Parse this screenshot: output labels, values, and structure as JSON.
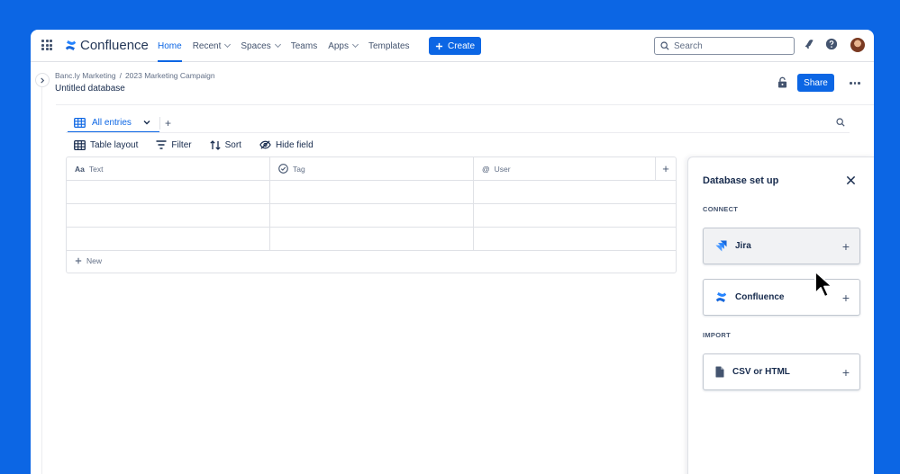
{
  "nav": {
    "product": "Confluence",
    "links": [
      {
        "label": "Home",
        "dropdown": false
      },
      {
        "label": "Recent",
        "dropdown": true
      },
      {
        "label": "Spaces",
        "dropdown": true
      },
      {
        "label": "Teams",
        "dropdown": false
      },
      {
        "label": "Apps",
        "dropdown": true
      },
      {
        "label": "Templates",
        "dropdown": false
      }
    ],
    "create_label": "Create",
    "search_placeholder": "Search",
    "icons": [
      "app-switcher-icon",
      "notifications-icon",
      "help-icon",
      "avatar"
    ]
  },
  "page": {
    "breadcrumb": [
      "Banc.ly Marketing",
      "/",
      "2023 Marketing Campaign"
    ],
    "title": "Untitled database",
    "share_label": "Share"
  },
  "database": {
    "view": {
      "label": "All entries"
    },
    "add_view": "+",
    "toolbar": {
      "layout": "Table layout",
      "filter": "Filter",
      "sort": "Sort",
      "hide": "Hide field"
    },
    "columns": [
      {
        "icon": "Aa",
        "label": "Text"
      },
      {
        "icon": "tag-icon",
        "label": "Tag"
      },
      {
        "icon": "@",
        "label": "User"
      }
    ],
    "add_column": "+",
    "new_row_label": "New"
  },
  "panel": {
    "title": "Database set up",
    "connect_label": "CONNECT",
    "import_label": "IMPORT",
    "connect_options": [
      {
        "label": "Jira",
        "icon": "jira-icon"
      },
      {
        "label": "Confluence",
        "icon": "confluence-icon"
      }
    ],
    "import_options": [
      {
        "label": "CSV or HTML",
        "icon": "file-icon"
      }
    ]
  },
  "colors": {
    "background": "#0C66E4",
    "accent": "#0C66E4",
    "text": "#172B4D"
  }
}
